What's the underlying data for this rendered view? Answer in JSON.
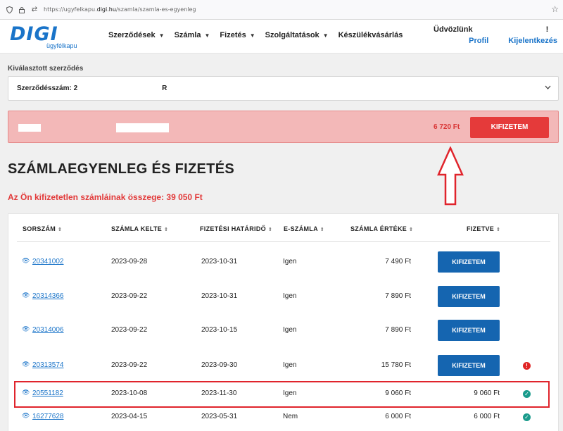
{
  "browser": {
    "url_prefix": "https://ugyfelkapu.",
    "url_domain": "digi.hu",
    "url_path": "/szamla/szamla-es-egyenleg"
  },
  "header": {
    "logo_text": "DIGI",
    "logo_sub": "ügyfélkapu",
    "nav": [
      "Szerződések",
      "Számla",
      "Fizetés",
      "Szolgáltatások",
      "Készülékvásárlás"
    ],
    "nav_has_dropdown": [
      true,
      true,
      true,
      true,
      false
    ],
    "welcome": "Üdvözlünk",
    "welcome_tail": "!",
    "profile": "Profil",
    "logout": "Kijelentkezés"
  },
  "contract": {
    "label": "Kiválasztott szerződés",
    "prefix": "Szerződésszám: 2",
    "suffix": "R"
  },
  "alert": {
    "amount": "6 720 Ft",
    "pay_label": "KIFIZETEM",
    "bg_color": "#f3b8b8"
  },
  "page": {
    "title": "SZÁMLAEGYENLEG ÉS FIZETÉS",
    "unpaid_text": "Az Ön kifizetetlen számláinak összege: 39 050 Ft"
  },
  "table": {
    "headers": [
      "SORSZÁM",
      "SZÁMLA KELTE",
      "FIZETÉSI HATÁRIDŐ",
      "E-SZÁMLA",
      "SZÁMLA ÉRTÉKE",
      "FIZETVE"
    ],
    "rows": [
      {
        "id": "20341002",
        "date": "2023-09-28",
        "due": "2023-10-31",
        "e": "Igen",
        "value": "7 490 Ft",
        "paid": "",
        "pay_button": "KIFIZETEM",
        "status": ""
      },
      {
        "id": "20314366",
        "date": "2023-09-22",
        "due": "2023-10-31",
        "e": "Igen",
        "value": "7 890 Ft",
        "paid": "",
        "pay_button": "KIFIZETEM",
        "status": ""
      },
      {
        "id": "20314006",
        "date": "2023-09-22",
        "due": "2023-10-15",
        "e": "Igen",
        "value": "7 890 Ft",
        "paid": "",
        "pay_button": "KIFIZETEM",
        "status": ""
      },
      {
        "id": "20313574",
        "date": "2023-09-22",
        "due": "2023-09-30",
        "e": "Igen",
        "value": "15 780 Ft",
        "paid": "",
        "pay_button": "KIFIZETEM",
        "status": "warn"
      },
      {
        "id": "20551182",
        "date": "2023-10-08",
        "due": "2023-11-30",
        "e": "Igen",
        "value": "9 060 Ft",
        "paid": "9 060 Ft",
        "pay_button": "",
        "status": "ok"
      },
      {
        "id": "16277628",
        "date": "2023-04-15",
        "due": "2023-05-31",
        "e": "Nem",
        "value": "6 000 Ft",
        "paid": "6 000 Ft",
        "pay_button": "",
        "status": "ok"
      }
    ]
  },
  "colors": {
    "brand": "#1a74c9",
    "pay_blue": "#1565b0",
    "pay_red": "#e53a3a",
    "annotation_red": "#e0242c"
  }
}
